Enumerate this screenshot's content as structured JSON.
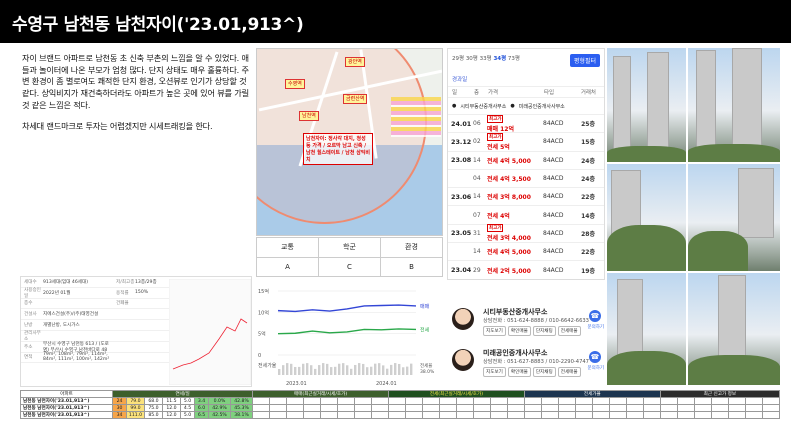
{
  "title": "수영구 남천동 남천자이('23.01,913^)",
  "description": [
    "자이 브랜드 아파트로 남천동 초 신축 부촌의 느낌을 알 수 있었다. 애들과 놀이터에 나온 부모가 엄청 많다. 단지 상태도 매우 훌륭하다. 주변 환경이 좀 별로여도 쾌적한 단지 환경, 오션뷰로 인기가 상당할 것 같다. 상익비지가 재건축하더라도 아파트가 높은 곳에 있어 뷰를 가릴 것 같은 느낌은 적다.",
    "차세대 랜드마크로 투자는 어렵겠지만 시세트래킹을 한다."
  ],
  "map": {
    "callouts": [
      "광안역",
      "금련산역",
      "남천역",
      "수영역"
    ],
    "note": "남천자이: 정사각 대지, 청성 등 가격 / 오르막 남고 신축 / 남천 힐스테이트 / 남천 삼익비치"
  },
  "school_table": {
    "headers": [
      "교통",
      "학군",
      "환경"
    ],
    "grades": [
      "A",
      "C",
      "B"
    ]
  },
  "listing": {
    "area_label": "34평",
    "area_sizes": [
      "29평",
      "30평",
      "33평",
      "34평",
      "73평"
    ],
    "filter_button": "평형필터",
    "sort_label": "경과일",
    "headers": [
      "일",
      "층",
      "가격",
      "타입",
      "거래처"
    ],
    "agencies": [
      "시티부동산중개사무소",
      "미래공인중개사사무소"
    ],
    "rows": [
      {
        "date": "24.01",
        "floor": "06",
        "tag": "최고가",
        "price": "매매 12억",
        "type": "84ACD",
        "count": "25층"
      },
      {
        "date": "23.12",
        "floor": "02",
        "tag": "최고가",
        "price": "전세 5억",
        "type": "84ACD",
        "count": "15층"
      },
      {
        "date": "23.08",
        "floor": "14",
        "tag": "",
        "price": "전세 4억 5,000",
        "type": "84ACD",
        "count": "24층"
      },
      {
        "date": "",
        "floor": "04",
        "tag": "",
        "price": "전세 4억 3,500",
        "type": "84ACD",
        "count": "24층"
      },
      {
        "date": "23.06",
        "floor": "14",
        "tag": "",
        "price": "전세 3억 8,000",
        "type": "84ACD",
        "count": "22층"
      },
      {
        "date": "",
        "floor": "07",
        "tag": "",
        "price": "전세 4억",
        "type": "84ACD",
        "count": "14층"
      },
      {
        "date": "23.05",
        "floor": "31",
        "tag": "최고가",
        "price": "전세 3억 4,000",
        "type": "84ACD",
        "count": "28층"
      },
      {
        "date": "",
        "floor": "14",
        "tag": "",
        "price": "전세 4억 5,000",
        "type": "84ACD",
        "count": "22층"
      },
      {
        "date": "23.04",
        "floor": "29",
        "tag": "",
        "price": "전세 2억 5,000",
        "type": "84ACD",
        "count": "19층"
      },
      {
        "date": "",
        "floor": "06",
        "tag": "",
        "price": "전세 3억 8,000",
        "type": "84ACD",
        "count": "6층"
      }
    ]
  },
  "chart_data": {
    "type": "line",
    "x": [
      "2023.01",
      "2024.01"
    ],
    "yticks": [
      "15억",
      "10억",
      "5억",
      "0"
    ],
    "series": [
      {
        "name": "매매",
        "values": [
          10.4,
          10.2,
          10.6,
          10.3,
          10.8,
          11.5,
          11.6,
          11.7,
          11.5
        ]
      },
      {
        "name": "전세",
        "values": [
          5.0,
          5.1,
          5.6,
          5.2,
          5.4,
          6.0,
          5.9,
          6.1,
          6.0
        ]
      }
    ],
    "bar_label": "전세가율",
    "rate_label": "전세율",
    "rate_value": "38.0%"
  },
  "agents": [
    {
      "name": "시티부동산중개사무소",
      "phone": "상담전화 : 051-624-8888 / 010-6642-6633",
      "buttons": [
        "지도보기",
        "확인매물",
        "단지채팅",
        "전세매물"
      ],
      "call": "문의하기"
    },
    {
      "name": "미래공인중개사사무소",
      "phone": "상담전화 : 051-627-8883 / 010-2290-4747",
      "buttons": [
        "지도보기",
        "확인매물",
        "단지채팅",
        "전세매물"
      ],
      "call": "문의하기"
    }
  ],
  "detail": {
    "rows": [
      [
        "세대수",
        "913세대(임대 46세대)",
        "저/최고층",
        "13층/29층"
      ],
      [
        "사용승인일",
        "2022년 01월",
        "용적률",
        "150%"
      ],
      [
        "층수",
        "",
        "건폐율",
        ""
      ],
      [
        "건설사",
        "지에스건설(주)/(주)태영건설",
        "",
        ""
      ],
      [
        "난방",
        "개별난방, 도시가스",
        "",
        ""
      ],
      [
        "관리사무소",
        "",
        "",
        ""
      ],
      [
        "주소",
        "부산시 수영구 남천동 613 / (도로명) 부산시 수영구 남천바다로 48",
        "",
        ""
      ],
      [
        "면적",
        "79m², 108m², 79m², 114m², 84m², 111m², 100m², 142m²",
        "",
        ""
      ]
    ]
  },
  "bottom_table": {
    "title_row": [
      "아파트",
      "연세/일",
      "매매(최근실거래/시세/호가)",
      "전세(최근실거래/시세/호가)",
      "전세가율",
      "최근 신고가 정보",
      "매매 지표/전세 지표"
    ],
    "rows": [
      {
        "name": "남천동 남천자이('23.01,913^)",
        "vals": [
          "24",
          "79.0",
          "68.0",
          "11.5",
          "5.0",
          "3.4",
          "0.0%",
          "42.8%"
        ]
      },
      {
        "name": "남천동 남천자이('23.01,913^)",
        "vals": [
          "30",
          "99.0",
          "75.0",
          "12.0",
          "4.5",
          "6.0",
          "42.9%",
          "45.3%"
        ]
      },
      {
        "name": "남천동 남천자이('23.01,913^)",
        "vals": [
          "34",
          "111.0",
          "85.0",
          "12.0",
          "5.0",
          "6.5",
          "42.5%",
          "38.1%"
        ]
      }
    ]
  }
}
